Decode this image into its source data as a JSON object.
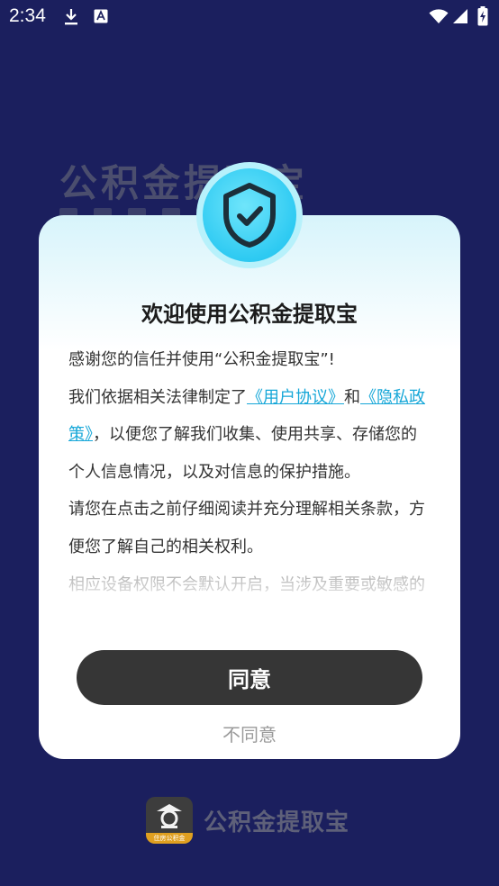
{
  "status_bar": {
    "time": "2:34"
  },
  "background": {
    "app_title": "公积金提取宝"
  },
  "dialog": {
    "title": "欢迎使用公积金提取宝",
    "para1": "感谢您的信任并使用“公积金提取宝”!",
    "para2_prefix": "我们依据相关法律制定了",
    "user_agreement_link": "《用户协议》",
    "para2_and": "和",
    "privacy_policy_link": "《隐私政策》",
    "para2_suffix": "，以便您了解我们收集、使用共享、存储您的个人信息情况，以及对信息的保护措施。",
    "para3": "请您在点击之前仔细阅读并充分理解相关条款，方便您了解自己的相关权利。",
    "para4": "相应设备权限不会默认开启，当涉及重要或敏感的设备权限时，我们会在您使用到相应业务功能",
    "agree_label": "同意",
    "disagree_label": "不同意"
  },
  "footer": {
    "logo_caption": "住房公积金",
    "app_name": "公积金提取宝"
  },
  "colors": {
    "background": "#1b1f5e",
    "accent": "#2ecaf2",
    "link": "#16a7d8",
    "button": "#363636"
  }
}
